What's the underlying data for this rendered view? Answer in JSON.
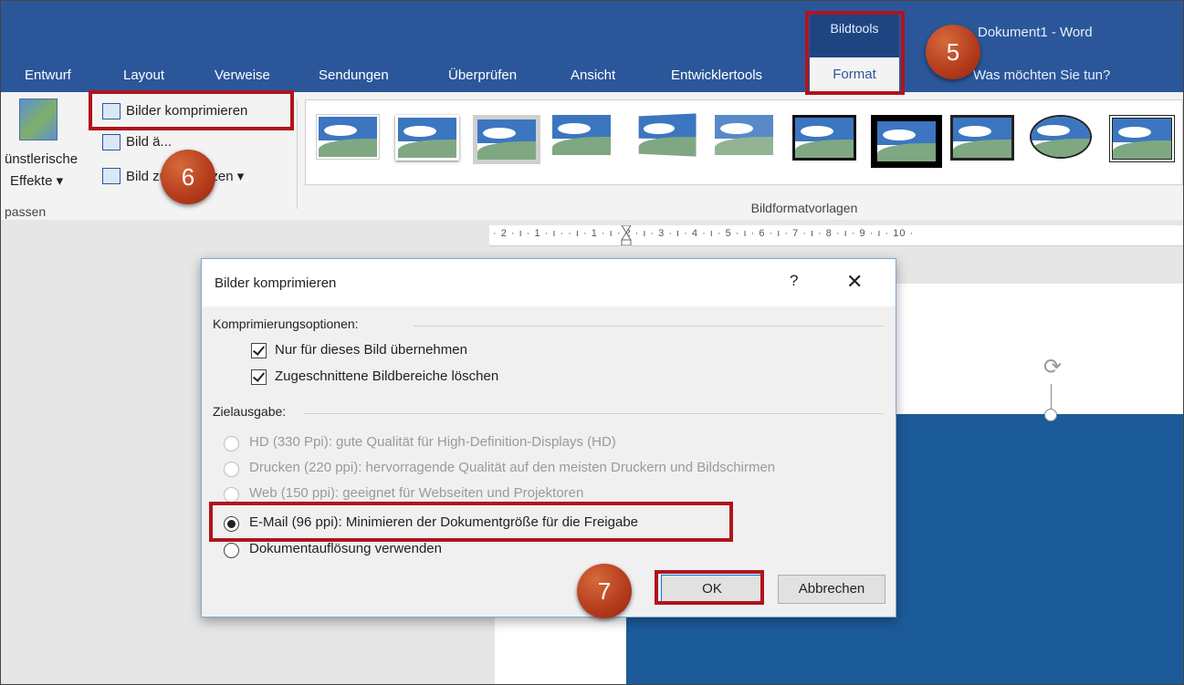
{
  "titlebar": {
    "context_group": "Bildtools",
    "doc_title": "Dokument1 - Word",
    "tell_me": "Was möchten Sie tun?"
  },
  "tabs": [
    "Entwurf",
    "Layout",
    "Verweise",
    "Sendungen",
    "Überprüfen",
    "Ansicht",
    "Entwicklertools"
  ],
  "format_tab": "Format",
  "ribbon": {
    "effects_label_1": "ünstlerische",
    "effects_label_2": "Effekte",
    "compress_label": "Bilder komprimieren",
    "change_label": "Bild ä...",
    "reset_label": "Bild zurücksetzen",
    "group_left_label": "passen",
    "gallery_label": "Bildformatvorlagen"
  },
  "ruler": "· 2 · ı · 1 · ı ·   · ı · 1 · ı · 2 · ı · 3 · ı · 4 · ı · 5 · ı · 6 · ı · 7 · ı · 8 · ı · 9 · ı · 10 ·",
  "dialog": {
    "title": "Bilder komprimieren",
    "help": "?",
    "close": "✕",
    "section_compression": "Komprimierungsoptionen:",
    "cb_only_this": "Nur für dieses Bild übernehmen",
    "cb_delete_cropped": "Zugeschnittene Bildbereiche löschen",
    "section_target": "Zielausgabe:",
    "opt_hd": "HD (330 Ppi): gute Qualität für High-Definition-Displays (HD)",
    "opt_print": "Drucken (220 ppi): hervorragende Qualität auf den meisten Druckern und Bildschirmen",
    "opt_web": "Web (150 ppi): geeignet für Webseiten und Projektoren",
    "opt_email": "E-Mail (96 ppi): Minimieren der Dokumentgröße für die Freigabe",
    "opt_doc_res": "Dokumentauflösung verwenden",
    "ok": "OK",
    "cancel": "Abbrechen"
  },
  "badges": {
    "step5": "5",
    "step6": "6",
    "step7": "7"
  },
  "colors": {
    "word_blue": "#2b579a",
    "highlight_red": "#b0141d",
    "badge_orange": "#b43a1c"
  }
}
